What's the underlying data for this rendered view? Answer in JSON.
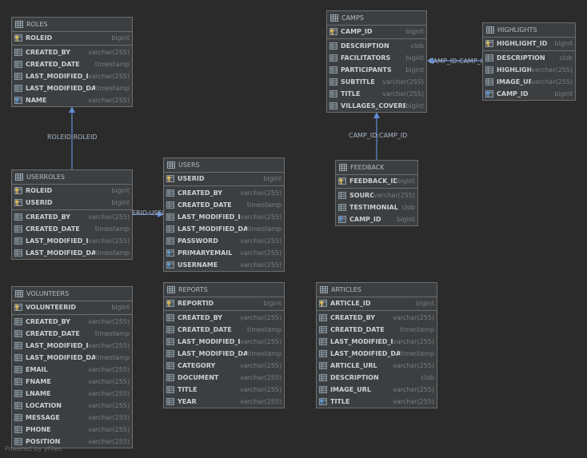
{
  "footer": "Powered by yFiles",
  "colors": {
    "background": "#2b2b2b",
    "table_bg": "#3c3f41",
    "edge": "#5f8dd3",
    "key_icon": "#d9b65a"
  },
  "tables": {
    "roles": {
      "name": "ROLES",
      "pk": [
        {
          "name": "ROLEID",
          "type": "bigint",
          "icon": "primary-key-icon"
        }
      ],
      "cols": [
        {
          "name": "CREATED_BY",
          "type": "varchar(255)",
          "icon": "column-icon"
        },
        {
          "name": "CREATED_DATE",
          "type": "timestamp",
          "icon": "column-icon"
        },
        {
          "name": "LAST_MODIFIED_BY",
          "type": "varchar(255)",
          "icon": "column-icon"
        },
        {
          "name": "LAST_MODIFIED_DATE",
          "type": "timestamp",
          "icon": "column-icon"
        },
        {
          "name": "NAME",
          "type": "varchar(255)",
          "icon": "unique-key-icon"
        }
      ]
    },
    "camps": {
      "name": "CAMPS",
      "pk": [
        {
          "name": "CAMP_ID",
          "type": "bigint",
          "icon": "primary-key-icon"
        }
      ],
      "cols": [
        {
          "name": "DESCRIPTION",
          "type": "clob",
          "icon": "column-icon"
        },
        {
          "name": "FACILITATORS",
          "type": "bigint",
          "icon": "column-icon"
        },
        {
          "name": "PARTICIPANTS",
          "type": "bigint",
          "icon": "column-icon"
        },
        {
          "name": "SUBTITLE",
          "type": "varchar(255)",
          "icon": "column-icon"
        },
        {
          "name": "TITLE",
          "type": "varchar(255)",
          "icon": "column-icon"
        },
        {
          "name": "VILLAGES_COVERED",
          "type": "bigint",
          "icon": "column-icon"
        }
      ]
    },
    "highlights": {
      "name": "HIGHLIGHTS",
      "pk": [
        {
          "name": "HIGHLIGHT_ID",
          "type": "bigint",
          "icon": "primary-key-icon"
        }
      ],
      "cols": [
        {
          "name": "DESCRIPTION",
          "type": "clob",
          "icon": "column-icon"
        },
        {
          "name": "HIGHLIGHT",
          "type": "varchar(255)",
          "icon": "column-icon"
        },
        {
          "name": "IMAGE_URL",
          "type": "varchar(255)",
          "icon": "column-icon"
        },
        {
          "name": "CAMP_ID",
          "type": "bigint",
          "icon": "foreign-key-icon"
        }
      ]
    },
    "userroles": {
      "name": "USERROLES",
      "pk": [
        {
          "name": "ROLEID",
          "type": "bigint",
          "icon": "primary-key-icon"
        },
        {
          "name": "USERID",
          "type": "bigint",
          "icon": "primary-key-icon"
        }
      ],
      "cols": [
        {
          "name": "CREATED_BY",
          "type": "varchar(255)",
          "icon": "column-icon"
        },
        {
          "name": "CREATED_DATE",
          "type": "timestamp",
          "icon": "column-icon"
        },
        {
          "name": "LAST_MODIFIED_BY",
          "type": "varchar(255)",
          "icon": "column-icon"
        },
        {
          "name": "LAST_MODIFIED_DATE",
          "type": "timestamp",
          "icon": "column-icon"
        }
      ]
    },
    "users": {
      "name": "USERS",
      "pk": [
        {
          "name": "USERID",
          "type": "bigint",
          "icon": "primary-key-icon"
        }
      ],
      "cols": [
        {
          "name": "CREATED_BY",
          "type": "varchar(255)",
          "icon": "column-icon"
        },
        {
          "name": "CREATED_DATE",
          "type": "timestamp",
          "icon": "column-icon"
        },
        {
          "name": "LAST_MODIFIED_BY",
          "type": "varchar(255)",
          "icon": "column-icon"
        },
        {
          "name": "LAST_MODIFIED_DATE",
          "type": "timestamp",
          "icon": "column-icon"
        },
        {
          "name": "PASSWORD",
          "type": "varchar(255)",
          "icon": "column-icon"
        },
        {
          "name": "PRIMARYEMAIL",
          "type": "varchar(255)",
          "icon": "unique-key-icon"
        },
        {
          "name": "USERNAME",
          "type": "varchar(255)",
          "icon": "unique-key-icon"
        }
      ]
    },
    "feedback": {
      "name": "FEEDBACK",
      "pk": [
        {
          "name": "FEEDBACK_ID",
          "type": "bigint",
          "icon": "primary-key-icon"
        }
      ],
      "cols": [
        {
          "name": "SOURCE",
          "type": "varchar(255)",
          "icon": "column-icon"
        },
        {
          "name": "TESTIMONIAL",
          "type": "clob",
          "icon": "column-icon"
        },
        {
          "name": "CAMP_ID",
          "type": "bigint",
          "icon": "foreign-key-icon"
        }
      ]
    },
    "volunteers": {
      "name": "VOLUNTEERS",
      "pk": [
        {
          "name": "VOLUNTEERID",
          "type": "bigint",
          "icon": "primary-key-icon"
        }
      ],
      "cols": [
        {
          "name": "CREATED_BY",
          "type": "varchar(255)",
          "icon": "column-icon"
        },
        {
          "name": "CREATED_DATE",
          "type": "timestamp",
          "icon": "column-icon"
        },
        {
          "name": "LAST_MODIFIED_BY",
          "type": "varchar(255)",
          "icon": "column-icon"
        },
        {
          "name": "LAST_MODIFIED_DATE",
          "type": "timestamp",
          "icon": "column-icon"
        },
        {
          "name": "EMAIL",
          "type": "varchar(255)",
          "icon": "column-icon"
        },
        {
          "name": "FNAME",
          "type": "varchar(255)",
          "icon": "column-icon"
        },
        {
          "name": "LNAME",
          "type": "varchar(255)",
          "icon": "column-icon"
        },
        {
          "name": "LOCATION",
          "type": "varchar(255)",
          "icon": "column-icon"
        },
        {
          "name": "MESSAGE",
          "type": "varchar(255)",
          "icon": "column-icon"
        },
        {
          "name": "PHONE",
          "type": "varchar(255)",
          "icon": "column-icon"
        },
        {
          "name": "POSITION",
          "type": "varchar(255)",
          "icon": "column-icon"
        }
      ]
    },
    "reports": {
      "name": "REPORTS",
      "pk": [
        {
          "name": "REPORTID",
          "type": "bigint",
          "icon": "primary-key-icon"
        }
      ],
      "cols": [
        {
          "name": "CREATED_BY",
          "type": "varchar(255)",
          "icon": "column-icon"
        },
        {
          "name": "CREATED_DATE",
          "type": "timestamp",
          "icon": "column-icon"
        },
        {
          "name": "LAST_MODIFIED_BY",
          "type": "varchar(255)",
          "icon": "column-icon"
        },
        {
          "name": "LAST_MODIFIED_DATE",
          "type": "timestamp",
          "icon": "column-icon"
        },
        {
          "name": "CATEGORY",
          "type": "varchar(255)",
          "icon": "column-icon"
        },
        {
          "name": "DOCUMENT",
          "type": "varchar(255)",
          "icon": "column-icon"
        },
        {
          "name": "TITLE",
          "type": "varchar(255)",
          "icon": "column-icon"
        },
        {
          "name": "YEAR",
          "type": "varchar(255)",
          "icon": "column-icon"
        }
      ]
    },
    "articles": {
      "name": "ARTICLES",
      "pk": [
        {
          "name": "ARTICLE_ID",
          "type": "bigint",
          "icon": "primary-key-icon"
        }
      ],
      "cols": [
        {
          "name": "CREATED_BY",
          "type": "varchar(255)",
          "icon": "column-icon"
        },
        {
          "name": "CREATED_DATE",
          "type": "timestamp",
          "icon": "column-icon"
        },
        {
          "name": "LAST_MODIFIED_BY",
          "type": "varchar(255)",
          "icon": "column-icon"
        },
        {
          "name": "LAST_MODIFIED_DATE",
          "type": "timestamp",
          "icon": "column-icon"
        },
        {
          "name": "ARTICLE_URL",
          "type": "varchar(255)",
          "icon": "column-icon"
        },
        {
          "name": "DESCRIPTION",
          "type": "clob",
          "icon": "column-icon"
        },
        {
          "name": "IMAGE_URL",
          "type": "varchar(255)",
          "icon": "column-icon"
        },
        {
          "name": "TITLE",
          "type": "varchar(255)",
          "icon": "unique-key-icon"
        }
      ]
    }
  },
  "edges": {
    "userroles_roles": "ROLEID:ROLEID",
    "userroles_users": "USERID:USERID",
    "highlights_camps": "CAMP_ID:CAMP_ID",
    "feedback_camps": "CAMP_ID:CAMP_ID"
  }
}
